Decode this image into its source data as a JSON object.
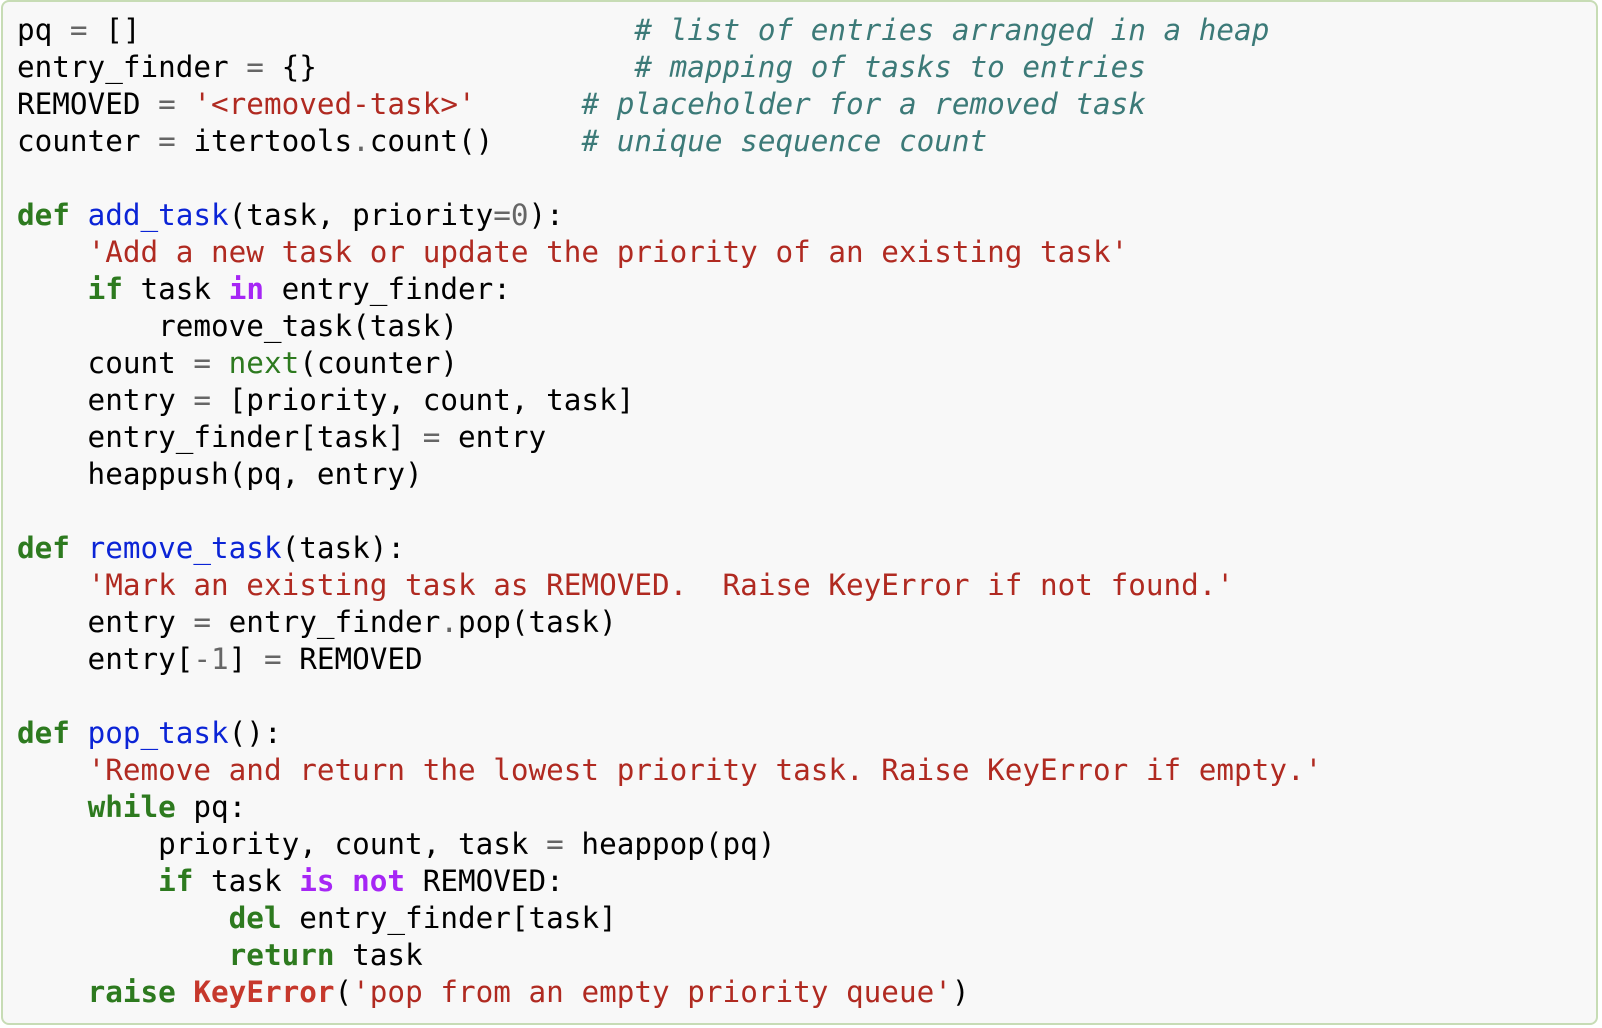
{
  "code": {
    "language": "python",
    "colors": {
      "background": "#f8f8f8",
      "border": "#c7dcb5",
      "keyword": "#2d7a1f",
      "operator_keyword": "#a626f5",
      "function_name": "#0b24d6",
      "string": "#b02a21",
      "comment": "#3c7a78",
      "operator": "#666666",
      "builtin": "#2d7a1f",
      "exception": "#c6382c",
      "text": "#000000"
    },
    "lines": [
      [
        [
          "plain",
          "pq "
        ],
        [
          "op",
          "="
        ],
        [
          "plain",
          " []                            "
        ],
        [
          "com",
          "# list of entries arranged in a heap"
        ]
      ],
      [
        [
          "plain",
          "entry_finder "
        ],
        [
          "op",
          "="
        ],
        [
          "plain",
          " {}                  "
        ],
        [
          "com",
          "# mapping of tasks to entries"
        ]
      ],
      [
        [
          "plain",
          "REMOVED "
        ],
        [
          "op",
          "="
        ],
        [
          "plain",
          " "
        ],
        [
          "str",
          "'<removed-task>'"
        ],
        [
          "plain",
          "      "
        ],
        [
          "com",
          "# placeholder for a removed task"
        ]
      ],
      [
        [
          "plain",
          "counter "
        ],
        [
          "op",
          "="
        ],
        [
          "plain",
          " itertools"
        ],
        [
          "op",
          "."
        ],
        [
          "plain",
          "count()     "
        ],
        [
          "com",
          "# unique sequence count"
        ]
      ],
      [],
      [
        [
          "kw",
          "def"
        ],
        [
          "plain",
          " "
        ],
        [
          "fn",
          "add_task"
        ],
        [
          "plain",
          "(task, priority"
        ],
        [
          "op",
          "="
        ],
        [
          "num",
          "0"
        ],
        [
          "plain",
          "):"
        ]
      ],
      [
        [
          "plain",
          "    "
        ],
        [
          "str",
          "'Add a new task or update the priority of an existing task'"
        ]
      ],
      [
        [
          "plain",
          "    "
        ],
        [
          "kw",
          "if"
        ],
        [
          "plain",
          " task "
        ],
        [
          "kw2",
          "in"
        ],
        [
          "plain",
          " entry_finder:"
        ]
      ],
      [
        [
          "plain",
          "        remove_task(task)"
        ]
      ],
      [
        [
          "plain",
          "    count "
        ],
        [
          "op",
          "="
        ],
        [
          "plain",
          " "
        ],
        [
          "bi",
          "next"
        ],
        [
          "plain",
          "(counter)"
        ]
      ],
      [
        [
          "plain",
          "    entry "
        ],
        [
          "op",
          "="
        ],
        [
          "plain",
          " [priority, count, task]"
        ]
      ],
      [
        [
          "plain",
          "    entry_finder[task] "
        ],
        [
          "op",
          "="
        ],
        [
          "plain",
          " entry"
        ]
      ],
      [
        [
          "plain",
          "    heappush(pq, entry)"
        ]
      ],
      [],
      [
        [
          "kw",
          "def"
        ],
        [
          "plain",
          " "
        ],
        [
          "fn",
          "remove_task"
        ],
        [
          "plain",
          "(task):"
        ]
      ],
      [
        [
          "plain",
          "    "
        ],
        [
          "str",
          "'Mark an existing task as REMOVED.  Raise KeyError if not found.'"
        ]
      ],
      [
        [
          "plain",
          "    entry "
        ],
        [
          "op",
          "="
        ],
        [
          "plain",
          " entry_finder"
        ],
        [
          "op",
          "."
        ],
        [
          "plain",
          "pop(task)"
        ]
      ],
      [
        [
          "plain",
          "    entry["
        ],
        [
          "op",
          "-"
        ],
        [
          "num",
          "1"
        ],
        [
          "plain",
          "] "
        ],
        [
          "op",
          "="
        ],
        [
          "plain",
          " REMOVED"
        ]
      ],
      [],
      [
        [
          "kw",
          "def"
        ],
        [
          "plain",
          " "
        ],
        [
          "fn",
          "pop_task"
        ],
        [
          "plain",
          "():"
        ]
      ],
      [
        [
          "plain",
          "    "
        ],
        [
          "str",
          "'Remove and return the lowest priority task. Raise KeyError if empty.'"
        ]
      ],
      [
        [
          "plain",
          "    "
        ],
        [
          "kw",
          "while"
        ],
        [
          "plain",
          " pq:"
        ]
      ],
      [
        [
          "plain",
          "        priority, count, task "
        ],
        [
          "op",
          "="
        ],
        [
          "plain",
          " heappop(pq)"
        ]
      ],
      [
        [
          "plain",
          "        "
        ],
        [
          "kw",
          "if"
        ],
        [
          "plain",
          " task "
        ],
        [
          "kw2",
          "is"
        ],
        [
          "plain",
          " "
        ],
        [
          "kw2",
          "not"
        ],
        [
          "plain",
          " REMOVED:"
        ]
      ],
      [
        [
          "plain",
          "            "
        ],
        [
          "kw",
          "del"
        ],
        [
          "plain",
          " entry_finder[task]"
        ]
      ],
      [
        [
          "plain",
          "            "
        ],
        [
          "kw",
          "return"
        ],
        [
          "plain",
          " task"
        ]
      ],
      [
        [
          "plain",
          "    "
        ],
        [
          "kw",
          "raise"
        ],
        [
          "plain",
          " "
        ],
        [
          "exc",
          "KeyError"
        ],
        [
          "plain",
          "("
        ],
        [
          "str",
          "'pop from an empty priority queue'"
        ],
        [
          "plain",
          ")"
        ]
      ]
    ]
  }
}
